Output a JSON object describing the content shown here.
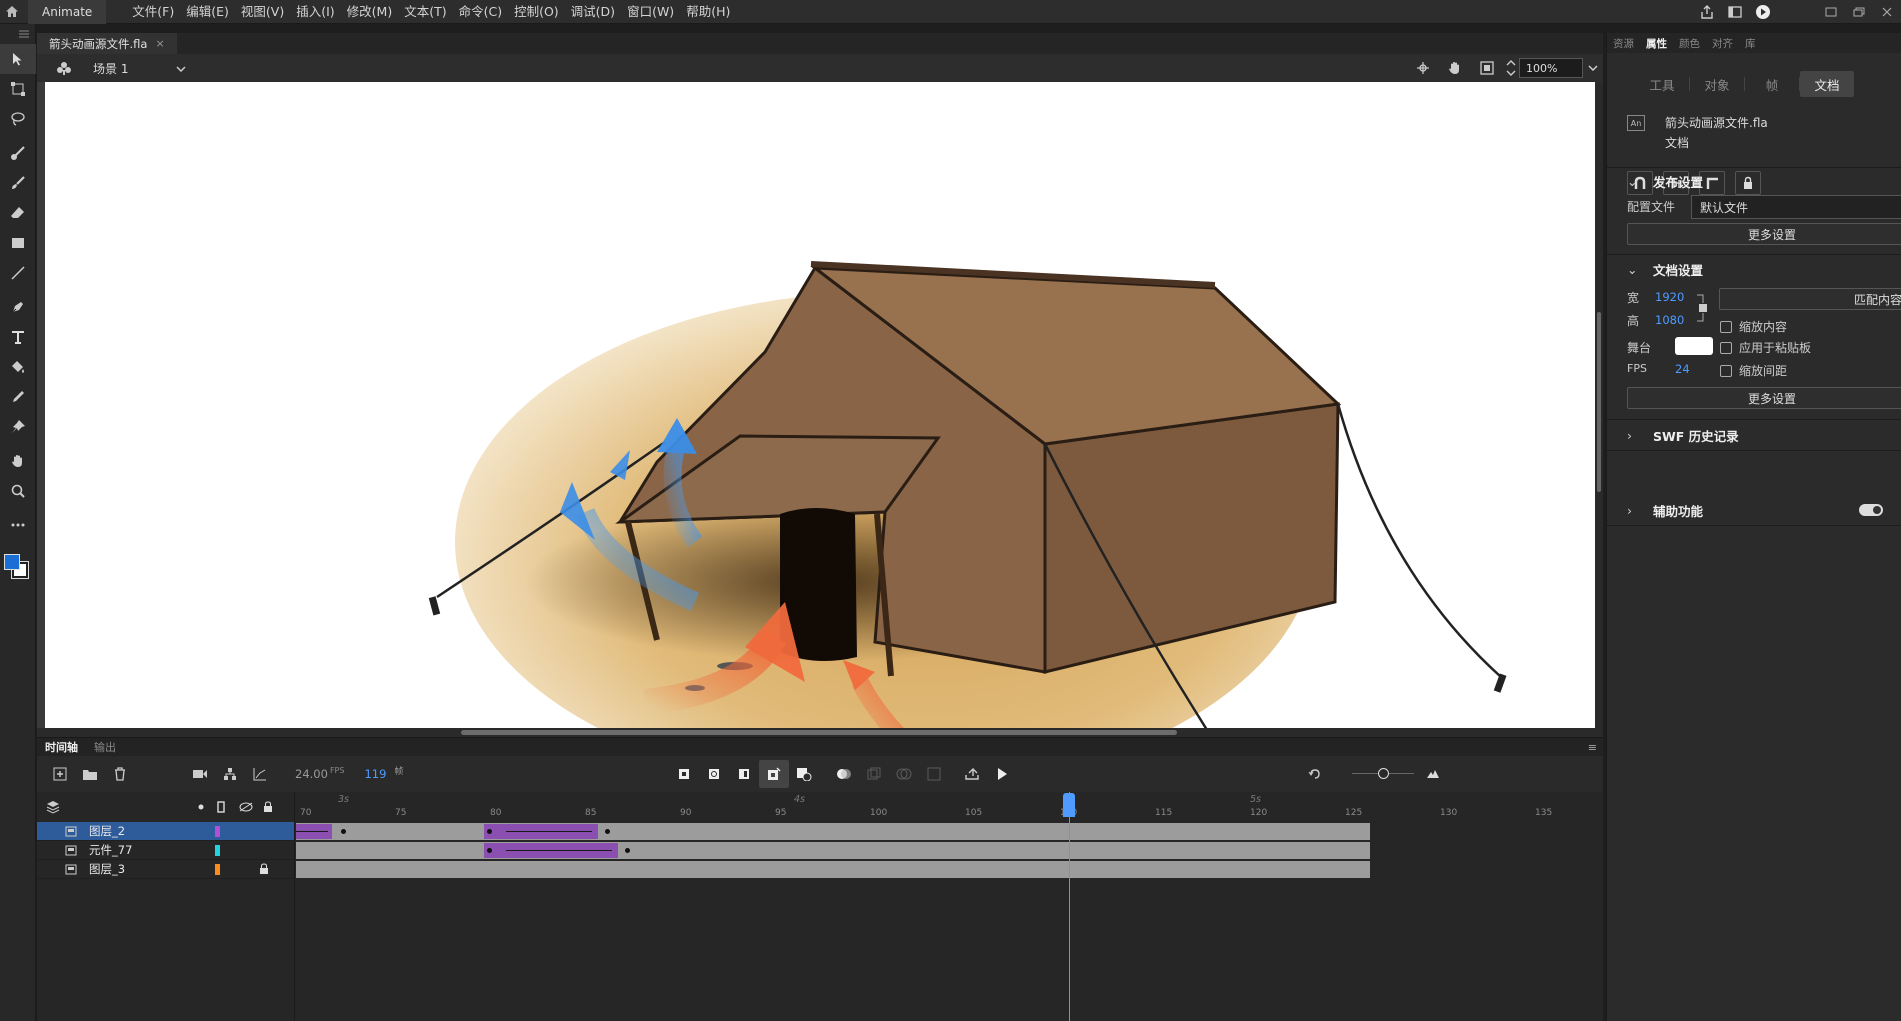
{
  "menubar": {
    "app_tab": "Animate",
    "menus": [
      "文件(F)",
      "编辑(E)",
      "视图(V)",
      "插入(I)",
      "修改(M)",
      "文本(T)",
      "命令(C)",
      "控制(O)",
      "调试(D)",
      "窗口(W)",
      "帮助(H)"
    ]
  },
  "document": {
    "tab_title": "箭头动画源文件.fla",
    "tab_close": "×",
    "scene": "场景 1",
    "zoom": "100%"
  },
  "toolbar": {
    "tools": [
      "selection-tool",
      "free-transform-tool",
      "lasso-tool",
      "asset-warp-tool",
      "brush-tool",
      "eraser-tool",
      "rectangle-tool",
      "line-tool",
      "pen-tool",
      "text-tool",
      "paint-bucket-tool",
      "eyedropper-tool",
      "pin-tool",
      "hand-tool",
      "zoom-tool",
      "more-tools"
    ],
    "stroke_color": "#1a6fd6",
    "fill_color": "#ffffff"
  },
  "right_panel": {
    "tabs": [
      "资源",
      "属性",
      "颜色",
      "对齐",
      "库"
    ],
    "active_tab": "属性",
    "subtabs": [
      "工具",
      "对象",
      "帧",
      "文档"
    ],
    "active_subtab": "文档",
    "doc_filename": "箭头动画源文件.fla",
    "doc_type": "文档",
    "doc_icon_text": "An",
    "publish": {
      "title": "发布设置",
      "profile_label": "配置文件",
      "profile_value": "默认文件",
      "more": "更多设置"
    },
    "docsettings": {
      "title": "文档设置",
      "width_label": "宽",
      "width": "1920",
      "height_label": "高",
      "height": "1080",
      "match_btn": "匹配内容",
      "scale_content": "缩放内容",
      "stage_label": "舞台",
      "stage_color": "#ffffff",
      "apply_pasteboard": "应用于粘贴板",
      "fps_label": "FPS",
      "fps": "24",
      "scale_spacing": "缩放间距",
      "more": "更多设置"
    },
    "swf_history": "SWF 历史记录",
    "accessibility": "辅助功能"
  },
  "timeline": {
    "tabs": [
      "时间轴",
      "输出"
    ],
    "fps": "24.00",
    "fps_unit": "FPS",
    "frame": "119",
    "frame_unit": "帧",
    "ruler_numbers": [
      "70",
      "75",
      "80",
      "85",
      "90",
      "95",
      "100",
      "105",
      "110",
      "115",
      "120",
      "125",
      "130",
      "135"
    ],
    "ruler_seconds": [
      "3s",
      "4s",
      "5s"
    ],
    "current_frame_number": 119,
    "layers": [
      {
        "name": "图层_2",
        "color": "#b34fd6",
        "selected": true,
        "locked": false
      },
      {
        "name": "元件_77",
        "color": "#22d3e0",
        "selected": false,
        "locked": false
      },
      {
        "name": "图层_3",
        "color": "#ff8c1a",
        "selected": false,
        "locked": true
      }
    ]
  },
  "colors": {
    "accent": "#4f9bff",
    "tween": "#8a4fb0",
    "selected_layer": "#2e5c9a"
  }
}
